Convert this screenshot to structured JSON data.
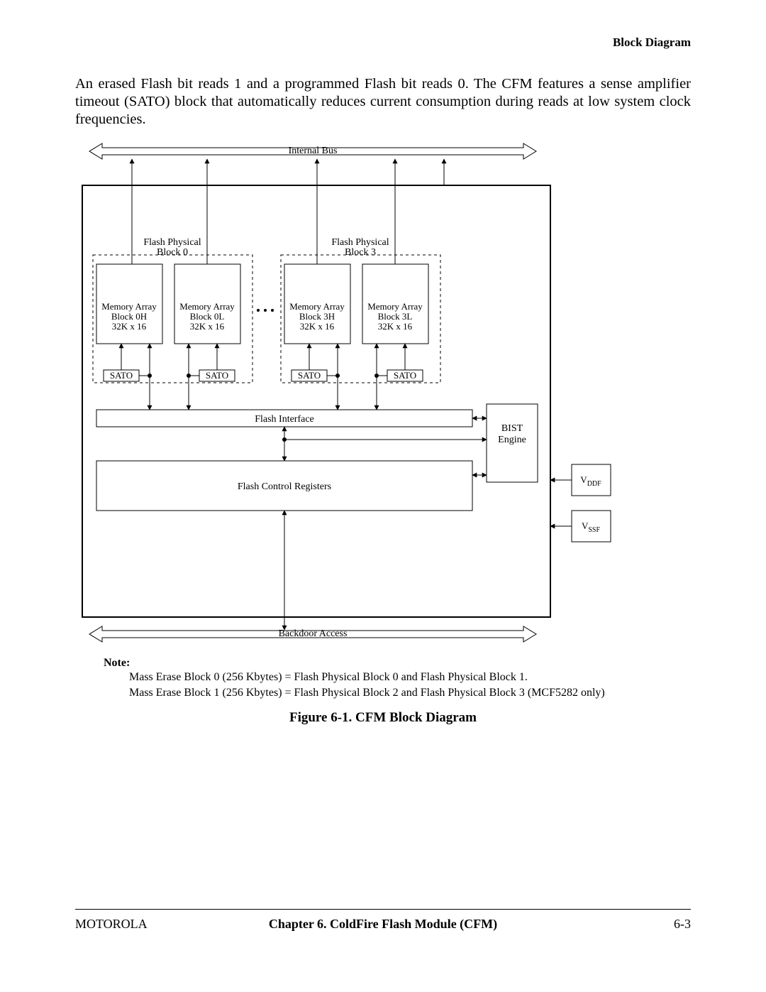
{
  "header": {
    "title": "Block Diagram"
  },
  "paragraph": "An erased Flash bit reads 1 and a programmed Flash bit reads 0. The CFM features a sense amplifier timeout (SATO) block that automatically reduces current consumption during reads at low system clock frequencies.",
  "diagram": {
    "internal_bus": "Internal Bus",
    "backdoor_access": "Backdoor Access",
    "flash_physical_0": {
      "l1": "Flash Physical",
      "l2": "Block 0"
    },
    "flash_physical_3": {
      "l1": "Flash Physical",
      "l2": "Block 3"
    },
    "mem_0H": {
      "l1": "Memory Array",
      "l2": "Block 0H",
      "l3": "32K x 16"
    },
    "mem_0L": {
      "l1": "Memory Array",
      "l2": "Block 0L",
      "l3": "32K x 16"
    },
    "mem_3H": {
      "l1": "Memory Array",
      "l2": "Block 3H",
      "l3": "32K x 16"
    },
    "mem_3L": {
      "l1": "Memory Array",
      "l2": "Block 3L",
      "l3": "32K x 16"
    },
    "sato": "SATO",
    "flash_interface": "Flash Interface",
    "flash_control": "Flash Control Registers",
    "bist": {
      "l1": "BIST",
      "l2": "Engine"
    },
    "vddf": "VDDF",
    "vssf": "VSSF"
  },
  "note": {
    "label": "Note:",
    "line1": "Mass Erase Block 0 (256 Kbytes) = Flash Physical Block 0 and Flash Physical Block 1.",
    "line2": "Mass Erase Block 1 (256 Kbytes) = Flash Physical Block 2 and Flash Physical Block 3 (MCF5282 only)"
  },
  "figure_caption": "Figure 6-1. CFM Block Diagram",
  "footer": {
    "left": "MOTOROLA",
    "center": "Chapter 6.  ColdFire Flash Module (CFM)",
    "right": "6-3"
  }
}
